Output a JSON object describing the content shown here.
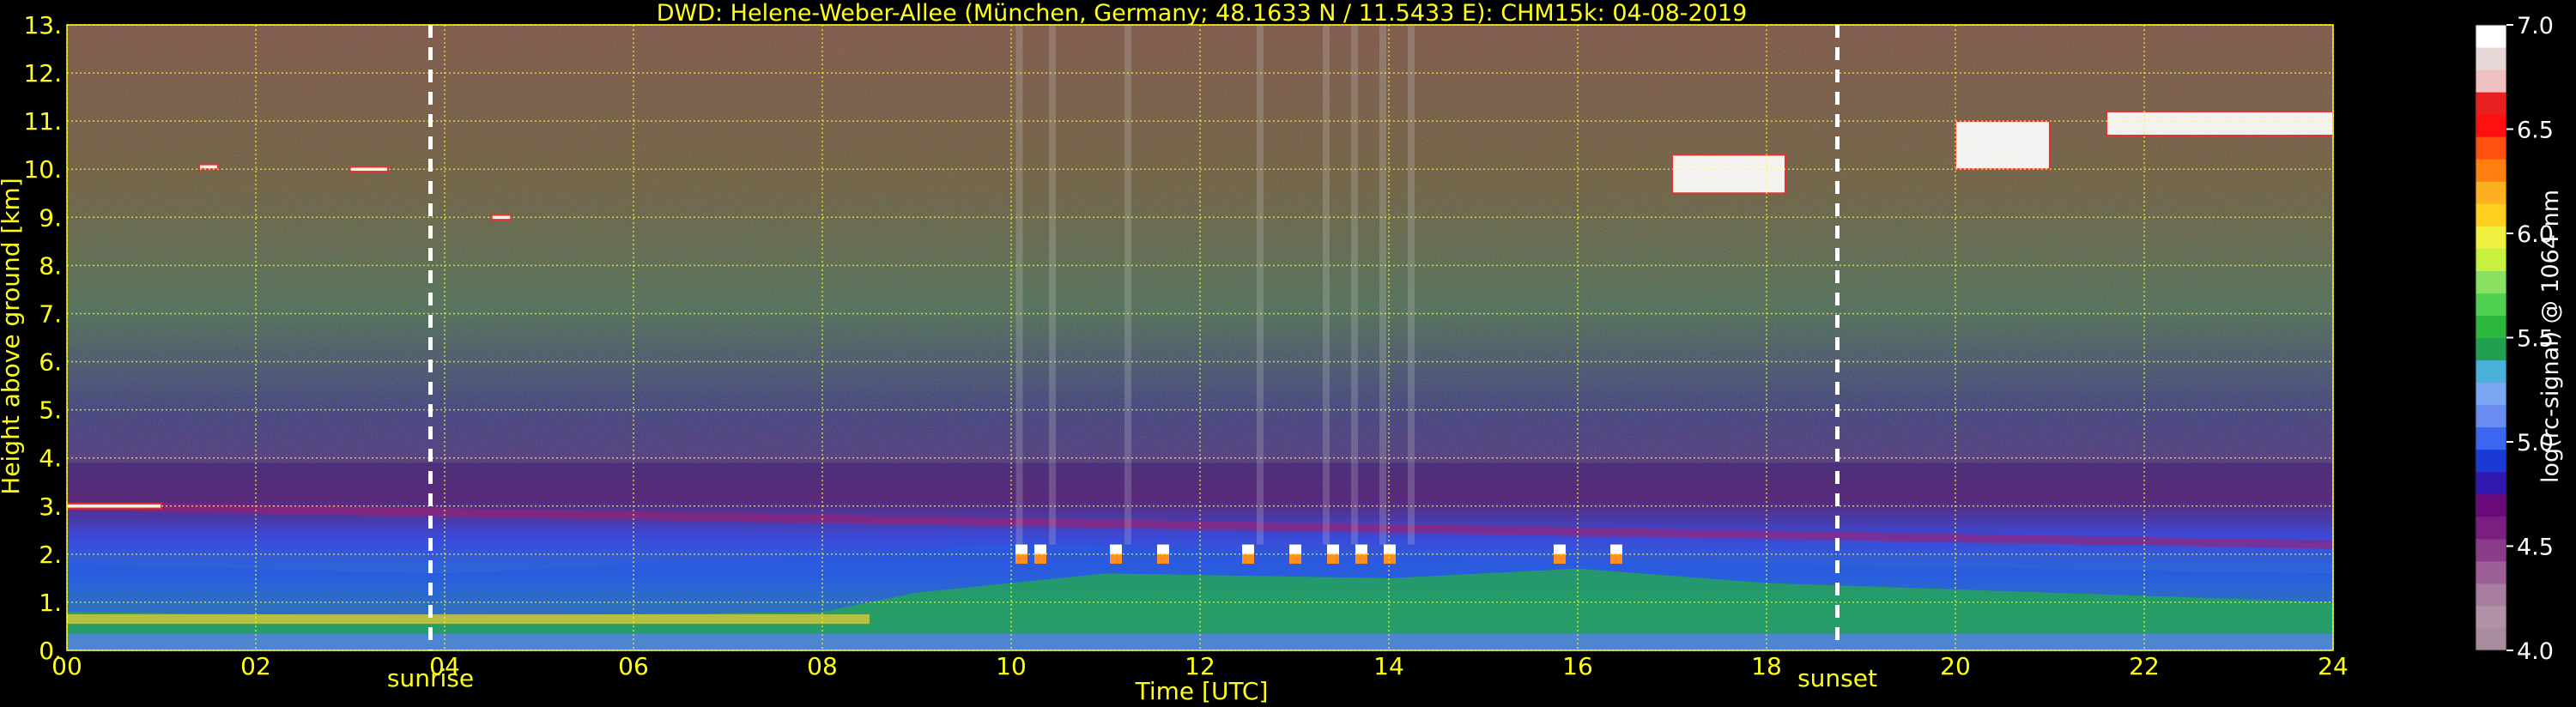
{
  "chart_data": {
    "type": "heatmap",
    "title": "DWD: Helene-Weber-Allee (München, Germany; 48.1633 N / 11.5433 E):    CHM15k: 04-08-2019",
    "xlabel": "Time [UTC]",
    "ylabel": "Height above ground [km]",
    "xlim": [
      0,
      24
    ],
    "ylim": [
      0,
      13
    ],
    "x_ticks": [
      "00",
      "02",
      "04",
      "06",
      "08",
      "10",
      "12",
      "14",
      "16",
      "18",
      "20",
      "22",
      "24"
    ],
    "y_ticks": [
      "0.",
      "1.",
      "2.",
      "3.",
      "4.",
      "5.",
      "6.",
      "7.",
      "8.",
      "9.",
      "10.",
      "11.",
      "12.",
      "13."
    ],
    "grid": true,
    "colorbar": {
      "label": "log(rc-signal) @ 1064 nm",
      "range": [
        4.0,
        7.0
      ],
      "ticks": [
        "4.0",
        "4.5",
        "5.0",
        "5.5",
        "6.0",
        "6.5",
        "7.0"
      ],
      "colors": [
        "#a88c9e",
        "#b292a6",
        "#a87ea0",
        "#9c6096",
        "#8a3c8a",
        "#7a1e82",
        "#6a0a7a",
        "#3018b0",
        "#1a3ad8",
        "#3a66f0",
        "#6a8cf0",
        "#7aa6f4",
        "#4ab0d8",
        "#20a050",
        "#2cb83c",
        "#50d050",
        "#8ae060",
        "#c8f040",
        "#f0f040",
        "#ffd020",
        "#ffb020",
        "#ff8010",
        "#ff5010",
        "#ff1010",
        "#e82020",
        "#f0c0c0",
        "#e8d8d8",
        "#ffffff"
      ]
    },
    "markers": [
      {
        "label": "sunrise",
        "time": 3.85
      },
      {
        "label": "sunset",
        "time": 18.75
      }
    ],
    "features": {
      "boundary_layer_top_km": [
        {
          "time": 0,
          "height": 1.8
        },
        {
          "time": 4,
          "height": 1.6
        },
        {
          "time": 8,
          "height": 2.0
        },
        {
          "time": 10,
          "height": 2.2
        },
        {
          "time": 14,
          "height": 2.0
        },
        {
          "time": 18,
          "height": 1.8
        },
        {
          "time": 24,
          "height": 1.6
        }
      ],
      "residual_layer_km": [
        {
          "time": 0,
          "height": 3.0
        },
        {
          "time": 12,
          "height": 2.6
        },
        {
          "time": 24,
          "height": 2.2
        }
      ],
      "cloud_patches": [
        {
          "t0": 0.0,
          "t1": 1.0,
          "h0": 2.95,
          "h1": 3.05
        },
        {
          "t0": 1.4,
          "t1": 1.6,
          "h0": 10.0,
          "h1": 10.1
        },
        {
          "t0": 3.0,
          "t1": 3.4,
          "h0": 9.95,
          "h1": 10.05
        },
        {
          "t0": 4.5,
          "t1": 4.7,
          "h0": 8.95,
          "h1": 9.05
        },
        {
          "t0": 17.0,
          "t1": 18.2,
          "h0": 9.5,
          "h1": 10.3
        },
        {
          "t0": 20.0,
          "t1": 21.0,
          "h0": 10.0,
          "h1": 11.0
        },
        {
          "t0": 21.6,
          "t1": 24.0,
          "h0": 10.7,
          "h1": 11.2
        }
      ]
    }
  }
}
